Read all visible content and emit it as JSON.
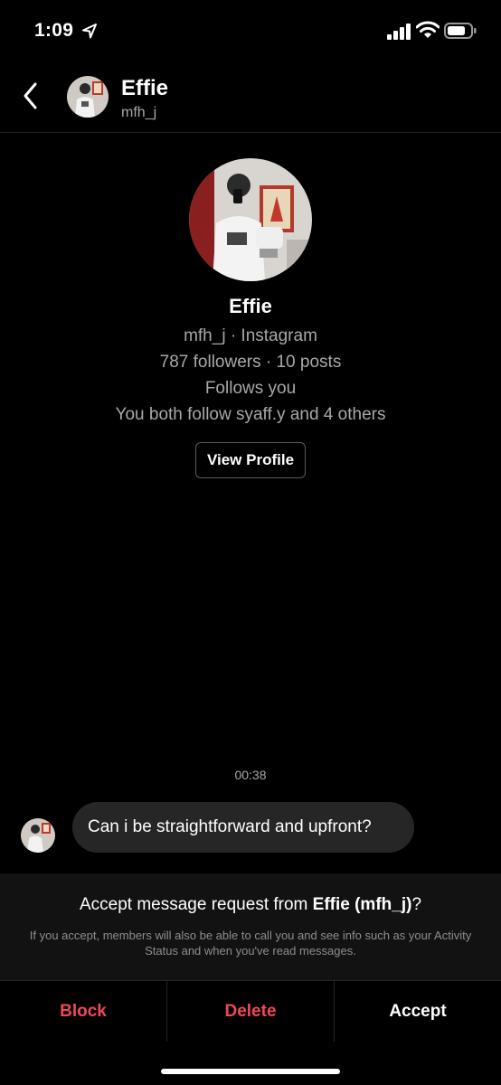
{
  "status_bar": {
    "time": "1:09",
    "icons": [
      "location-arrow-icon",
      "cellular-signal-icon",
      "wifi-icon",
      "battery-icon"
    ]
  },
  "header": {
    "back_icon": "chevron-left-icon",
    "name": "Effie",
    "handle": "mfh_j"
  },
  "profile": {
    "name": "Effie",
    "handle_line": "mfh_j · Instagram",
    "stats_line": "787 followers · 10 posts",
    "follows_line": "Follows you",
    "mutual_line": "You both follow syaff.y and 4 others",
    "view_profile_label": "View Profile"
  },
  "conversation": {
    "timestamp": "00:38",
    "message": "Can i be straightforward and upfront?"
  },
  "request": {
    "title_prefix": "Accept message request from ",
    "title_name": "Effie (mfh_j)",
    "title_suffix": "?",
    "note": "If you accept, members will also be able to call you and see info such as your Activity Status and when you've read messages."
  },
  "actions": {
    "block_label": "Block",
    "delete_label": "Delete",
    "accept_label": "Accept"
  },
  "colors": {
    "background": "#000000",
    "danger": "#ed4956",
    "bubble": "#262626",
    "secondary_text": "#a8a8a8"
  }
}
